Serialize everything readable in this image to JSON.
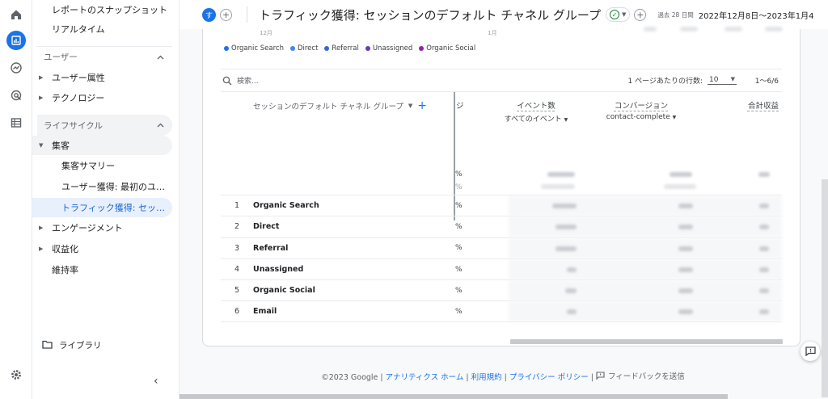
{
  "header": {
    "avatar_letter": "す",
    "plus": "+",
    "title": "トラフィック獲得: セッションのデフォルト チャネル グループ",
    "date_prefix": "過去 28 日間",
    "date_range": "2022年12月8日〜2023年1月4"
  },
  "nav": {
    "items_top": [
      {
        "label": "レポートのスナップショット"
      },
      {
        "label": "リアルタイム"
      }
    ],
    "section_user": "ユーザー",
    "user_items": [
      {
        "label": "ユーザー属性"
      },
      {
        "label": "テクノロジー"
      }
    ],
    "section_lifecycle": "ライフサイクル",
    "lifecycle_group": "集客",
    "lifecycle_children": [
      {
        "label": "集客サマリー"
      },
      {
        "label": "ユーザー獲得: 最初のユーザ..."
      },
      {
        "label": "トラフィック獲得: セッショ..."
      }
    ],
    "lifecycle_rest": [
      {
        "label": "エンゲージメント"
      },
      {
        "label": "収益化"
      },
      {
        "label": "維持率"
      }
    ],
    "library": "ライブラリ"
  },
  "chart": {
    "tick_left": "12月",
    "tick_right": "1月",
    "legend": [
      {
        "name": "Organic Search",
        "color": "#1a73e8"
      },
      {
        "name": "Direct",
        "color": "#4285f4"
      },
      {
        "name": "Referral",
        "color": "#3367d6"
      },
      {
        "name": "Unassigned",
        "color": "#673ab7"
      },
      {
        "name": "Organic Social",
        "color": "#8e24aa"
      }
    ]
  },
  "table": {
    "search_placeholder": "検索...",
    "rows_per_page_label": "1 ページあたりの行数:",
    "rows_per_page_value": "10",
    "pager": "1〜6/6",
    "dimension_header": "セッションのデフォルト チャネル グループ",
    "partial_header": "ジ率",
    "columns": [
      {
        "title": "イベント数",
        "sub": "すべてのイベント"
      },
      {
        "title": "コンバージョン",
        "sub": "contact-complete"
      },
      {
        "title": "合計収益",
        "sub": ""
      }
    ],
    "pct_symbol": "%",
    "rows": [
      {
        "idx": "1",
        "name": "Organic Search"
      },
      {
        "idx": "2",
        "name": "Direct"
      },
      {
        "idx": "3",
        "name": "Referral"
      },
      {
        "idx": "4",
        "name": "Unassigned"
      },
      {
        "idx": "5",
        "name": "Organic Social"
      },
      {
        "idx": "6",
        "name": "Email"
      }
    ]
  },
  "footer": {
    "copyright": "©2023 Google",
    "links": [
      "アナリティクス ホーム",
      "利用規約",
      "プライバシー ポリシー"
    ],
    "feedback": "フィードバックを送信"
  }
}
